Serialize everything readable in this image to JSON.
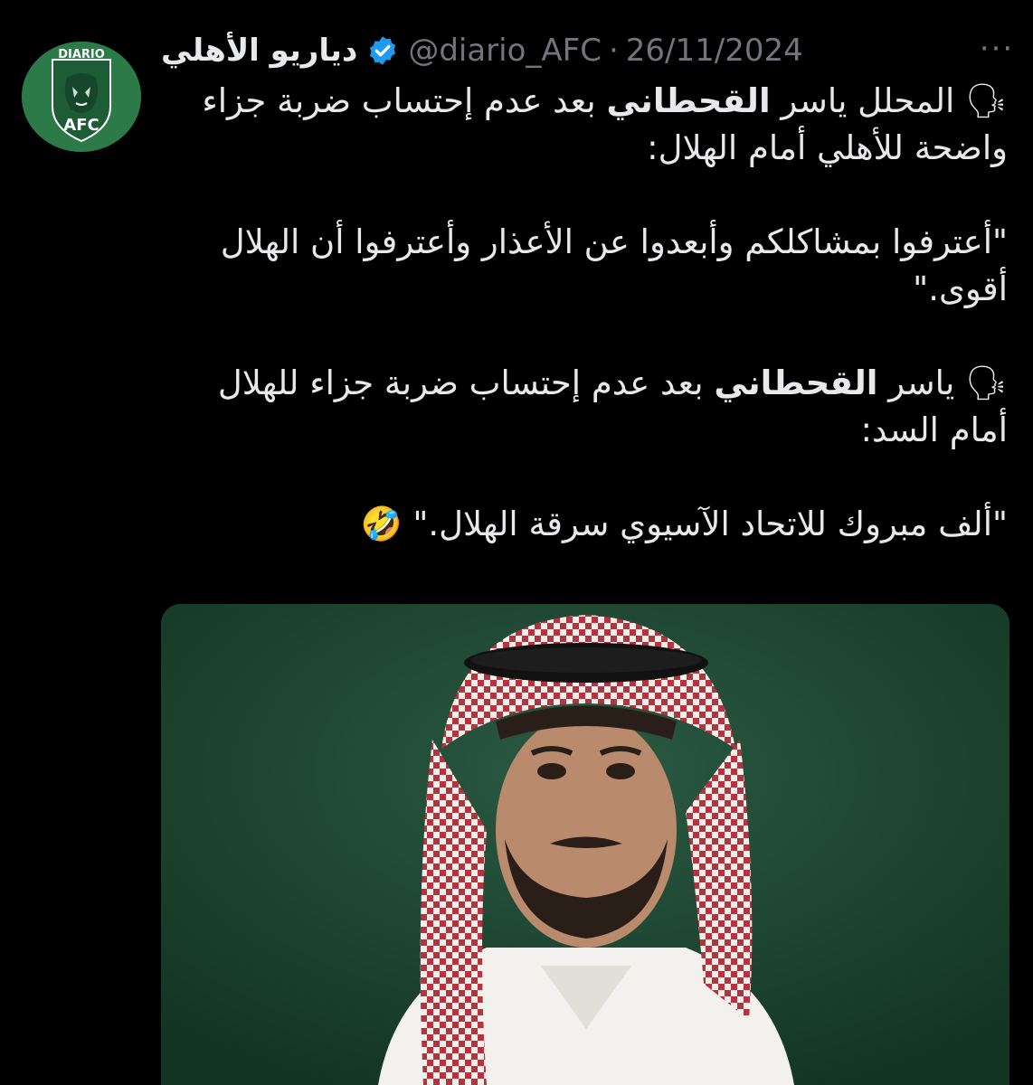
{
  "author": {
    "display_name": "دياريو الأهلي",
    "handle": "@diario_AFC",
    "separator": "·",
    "date": "26/11/2024",
    "avatar_text_top": "DIARIO",
    "avatar_text_bottom": "AFC"
  },
  "menu": {
    "more_label": "···"
  },
  "tweet": {
    "para1_emoji": "🗣",
    "para1_pre": "المحلل ياسر ",
    "para1_bold": "القحطاني",
    "para1_post": " بعد عدم إحتساب ضربة جزاء واضحة للأهلي أمام الهلال:",
    "quote1": "\"أعترفوا بمشاكلكم وأبعدوا عن الأعذار وأعترفوا أن الهلال أقوى.\"",
    "para2_emoji": "🗣",
    "para2_pre": "ياسر ",
    "para2_bold": "القحطاني",
    "para2_post": " بعد عدم إحتساب ضربة جزاء للهلال أمام السد:",
    "quote2": "\"ألف مبروك للاتحاد الآسيوي سرقة الهلال.\"",
    "quote2_emoji": "🤣"
  },
  "icons": {
    "verified": "verified-badge-icon",
    "more": "more-horizontal-icon"
  },
  "colors": {
    "background": "#000000",
    "text": "#e7e9ea",
    "secondary": "#71767b",
    "verified": "#1d9bf0",
    "avatar_green": "#2b7a47"
  }
}
